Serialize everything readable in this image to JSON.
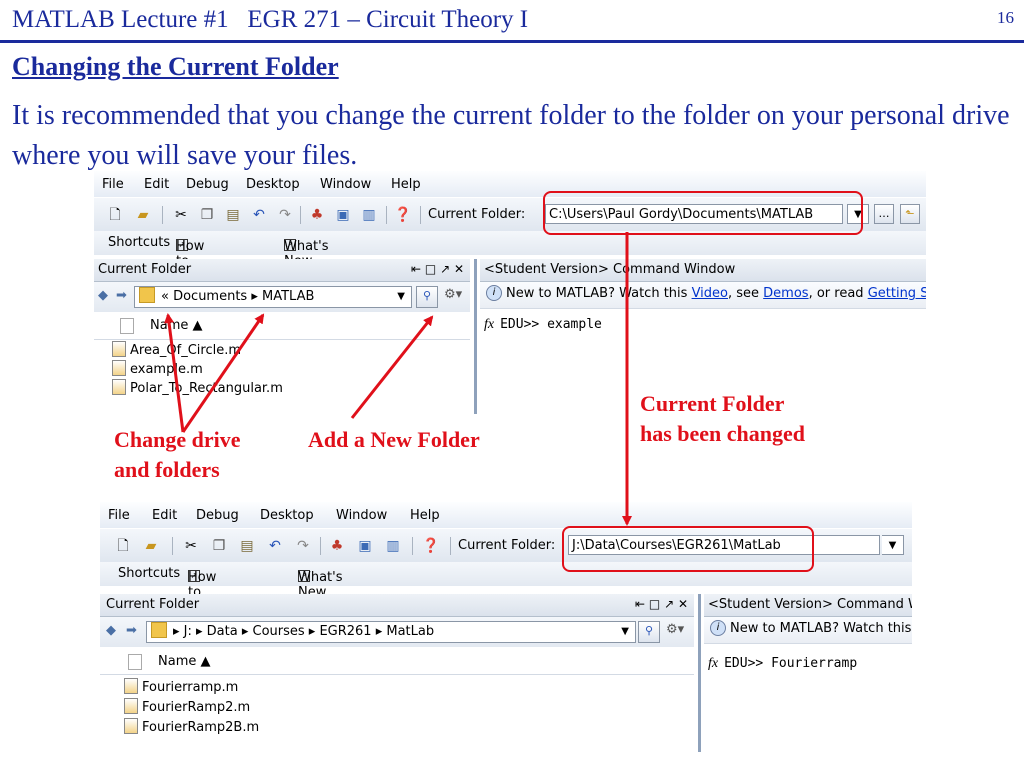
{
  "slide": {
    "header": "MATLAB Lecture #1   EGR 271 – Circuit Theory I",
    "page_number": "16",
    "subtitle": "Changing the Current Folder",
    "intro": "It is recommended that you change the current folder to the folder on your personal drive where you will save your files."
  },
  "annotations": {
    "change_drive": [
      "Change drive",
      "and folders"
    ],
    "add_folder": "Add a New Folder",
    "folder_changed": [
      "Current Folder",
      "has been changed"
    ],
    "accent_color": "#e0101a"
  },
  "menu": [
    "File",
    "Edit",
    "Debug",
    "Desktop",
    "Window",
    "Help"
  ],
  "toolbar_icons": [
    "new-file-icon",
    "open-folder-icon",
    "cut-icon",
    "copy-icon",
    "paste-icon",
    "undo-icon",
    "redo-icon",
    "simulink-icon",
    "guide-icon",
    "profiler-icon",
    "help-icon"
  ],
  "current_folder_label": "Current Folder:",
  "shortcuts": {
    "label": "Shortcuts",
    "how_to_add": "How to Add",
    "whats_new": "What's New"
  },
  "top": {
    "current_folder_path": "C:\\Users\\Paul Gordy\\Documents\\MATLAB",
    "panel_title": "Current Folder",
    "panel_controls": "⇤ □ ↗ ✕",
    "breadcrumb": "«  Documents  ▸  MATLAB",
    "name_header": "Name ▲",
    "files": [
      "Area_Of_Circle.m",
      "example.m",
      "Polar_To_Rectangular.m"
    ],
    "cw_title": "<Student Version> Command Window",
    "cw_info_prefix": "New to MATLAB? Watch this ",
    "cw_info_video": "Video",
    "cw_info_mid": ", see ",
    "cw_info_demos": "Demos",
    "cw_info_mid2": ", or read ",
    "cw_info_getting": "Getting Started",
    "prompt": "EDU>> example"
  },
  "bottom": {
    "current_folder_path": "J:\\Data\\Courses\\EGR261\\MatLab",
    "panel_title": "Current Folder",
    "panel_controls": "⇤ □ ↗ ✕",
    "breadcrumb": "▸  J:  ▸  Data  ▸  Courses  ▸  EGR261  ▸  MatLab",
    "name_header": "Name ▲",
    "files": [
      "Fourierramp.m",
      "FourierRamp2.m",
      "FourierRamp2B.m"
    ],
    "cw_title": "<Student Version> Command Window",
    "cw_info": "New to MATLAB? Watch this Video",
    "prompt": "EDU>> Fourierramp"
  }
}
